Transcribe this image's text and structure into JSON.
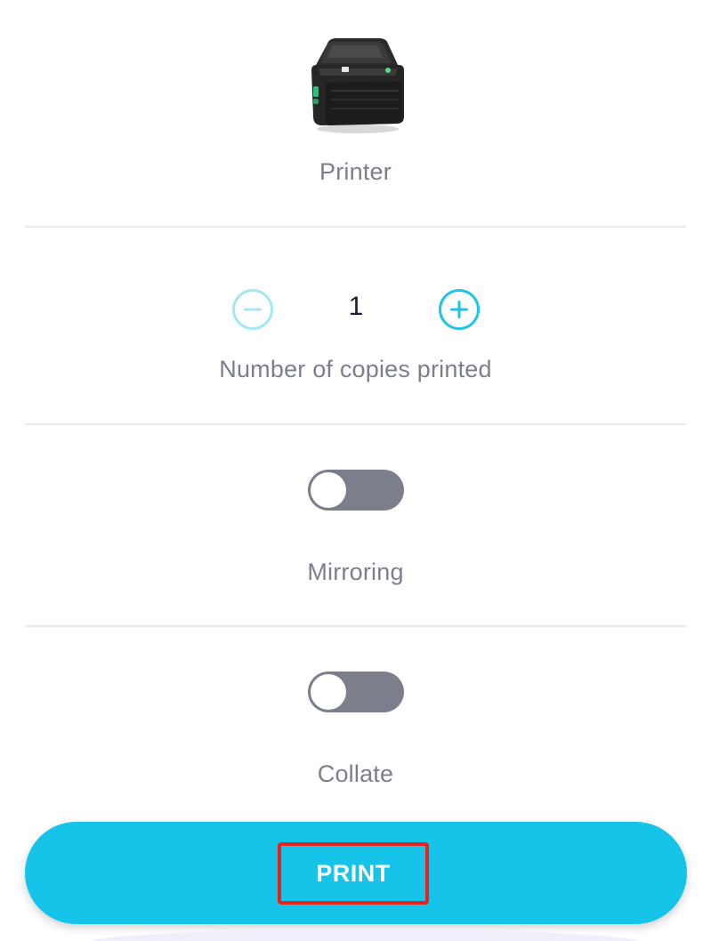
{
  "printer": {
    "label": "Printer",
    "icon": "printer-icon"
  },
  "copies": {
    "value": "1",
    "label": "Number of copies printed",
    "decrement_icon": "minus-circle-icon",
    "increment_icon": "plus-circle-icon"
  },
  "mirroring": {
    "label": "Mirroring",
    "enabled": false
  },
  "collate": {
    "label": "Collate",
    "enabled": false
  },
  "print_button": {
    "label": "PRINT"
  },
  "colors": {
    "accent": "#16c4ea",
    "toggle_off": "#7b7f8c",
    "highlight_border": "#e8221b",
    "label_text": "#7b7f8c"
  }
}
